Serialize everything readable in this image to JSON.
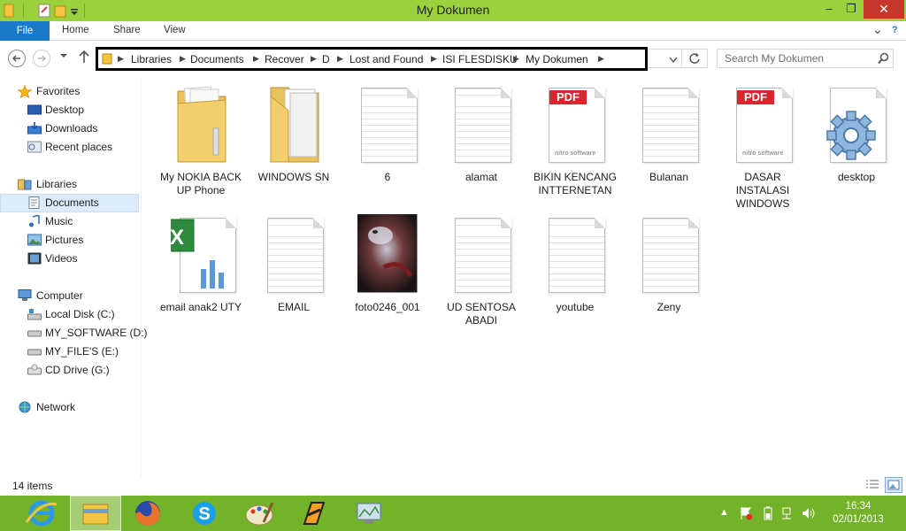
{
  "window": {
    "title": "My Dokumen",
    "minimize": "–",
    "restore": "❐",
    "close": "✕"
  },
  "ribbon": {
    "file": "File",
    "tabs": [
      "Home",
      "Share",
      "View"
    ],
    "expand": "⌄",
    "help": "?"
  },
  "address": {
    "crumbs": [
      "Libraries",
      "Documents",
      "Recover",
      "D",
      "Lost and Found",
      "ISI FLESDISKU",
      "My Dokumen"
    ],
    "search_placeholder": "Search My Dokumen"
  },
  "nav": {
    "favorites": {
      "label": "Favorites",
      "items": [
        "Desktop",
        "Downloads",
        "Recent places"
      ]
    },
    "libraries": {
      "label": "Libraries",
      "items": [
        "Documents",
        "Music",
        "Pictures",
        "Videos"
      ]
    },
    "computer": {
      "label": "Computer",
      "items": [
        "Local Disk (C:)",
        "MY_SOFTWARE (D:)",
        "MY_FILE'S (E:)",
        "CD Drive (G:)"
      ]
    },
    "network": {
      "label": "Network"
    }
  },
  "files": [
    {
      "name": "My NOKIA BACK UP Phone",
      "icon": "folder-icon"
    },
    {
      "name": "WINDOWS SN",
      "icon": "folder-icon"
    },
    {
      "name": "6",
      "icon": "text-file-icon"
    },
    {
      "name": "alamat",
      "icon": "text-file-icon"
    },
    {
      "name": "BIKIN KENCANG INTTERNETAN",
      "icon": "pdf-file-icon"
    },
    {
      "name": "Bulanan",
      "icon": "text-file-icon"
    },
    {
      "name": "DASAR INSTALASI WINDOWS",
      "icon": "pdf-file-icon"
    },
    {
      "name": "desktop",
      "icon": "settings-file-icon"
    },
    {
      "name": "email anak2 UTY",
      "icon": "excel-file-icon"
    },
    {
      "name": "EMAIL",
      "icon": "text-file-icon"
    },
    {
      "name": "foto0246_001",
      "icon": "photo-thumbnail-icon"
    },
    {
      "name": "UD SENTOSA ABADI",
      "icon": "text-file-icon"
    },
    {
      "name": "youtube",
      "icon": "text-file-icon"
    },
    {
      "name": "Zeny",
      "icon": "text-file-icon"
    }
  ],
  "pdf_badge": "PDF",
  "nitro_label": "nitro software",
  "status": {
    "count": "14 items"
  },
  "taskbar": {
    "time": "16:34",
    "date": "02/01/2013",
    "apps": [
      "internet-explorer-icon",
      "file-explorer-icon",
      "firefox-icon",
      "skype-icon",
      "paint-icon",
      "winamp-icon",
      "monitor-app-icon"
    ]
  },
  "colors": {
    "titlebar": "#9bd13c",
    "taskbar": "#74b22a",
    "file_tab": "#1979ca",
    "close": "#c7352b",
    "selection": "#dcebfc"
  }
}
